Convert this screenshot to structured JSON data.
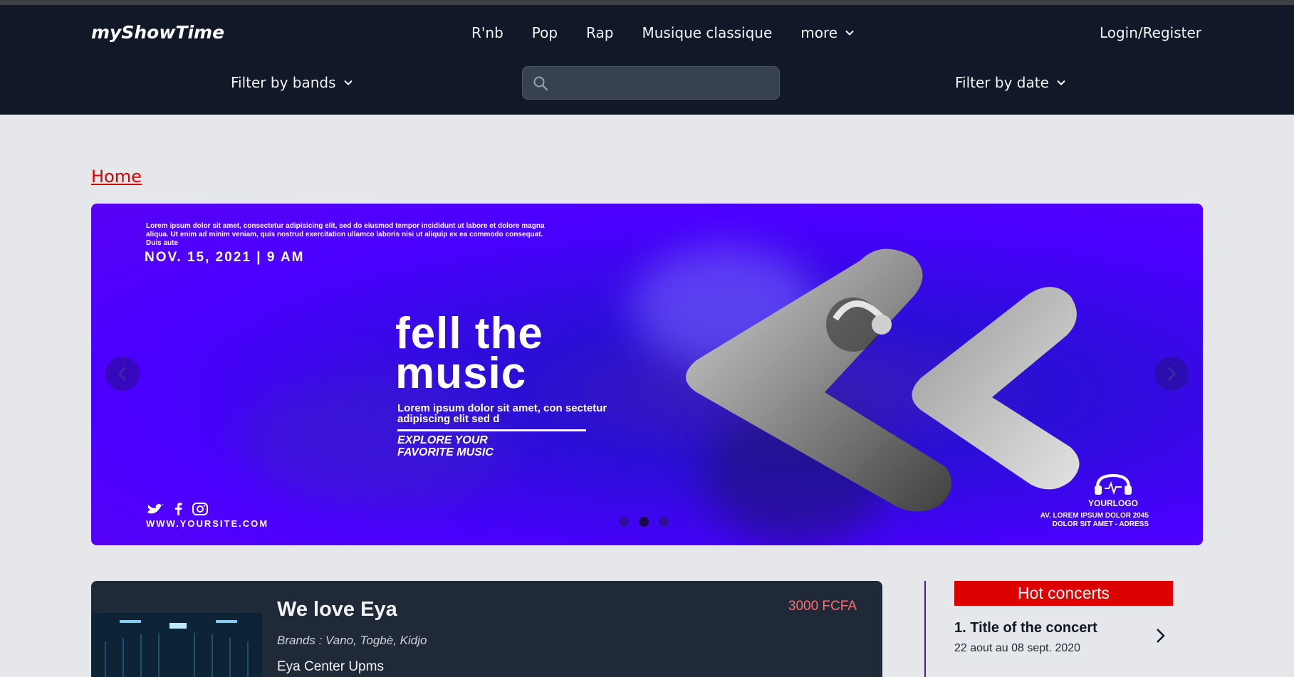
{
  "nav": {
    "brand": "myShowTime",
    "links": [
      "R'nb",
      "Pop",
      "Rap",
      "Musique classique"
    ],
    "more_label": "more",
    "login_label": "Login/Register",
    "filter_bands_label": "Filter by bands",
    "filter_date_label": "Filter by date",
    "search": {
      "placeholder": "",
      "value": ""
    }
  },
  "breadcrumb": {
    "home": "Home"
  },
  "carousel": {
    "small_text": "Lorem ipsum dolor sit amet, consectetur adipisicing elit, sed do eiusmod tempor incididunt ut labore et dolore magna aliqua. Ut enim ad minim veniam, quis nostrud exercitation ullamco laboris nisi ut aliquip ex ea commodo consequat. Duis aute",
    "date": "NOV. 15, 2021 |  9 AM",
    "title_line1": "fell the",
    "title_line2": "music",
    "subtitle": "Lorem ipsum dolor sit amet, con sectetur adipiscing elit sed d",
    "explore_line1": "EXPLORE YOUR",
    "explore_line2": "FAVORITE MUSIC",
    "website": "WWW.YOURSITE.COM",
    "logo_text": "YOURLOGO",
    "address_line1": "AV. LOREM IPSUM DOLOR 2045",
    "address_line2": "DOLOR SIT AMET - ADRESS",
    "dots": 3,
    "active_dot": 1
  },
  "card": {
    "title": "We love Eya",
    "price": "3000 FCFA",
    "brands": "Brands : Vano, Togbè, Kidjo",
    "venue": "Eya Center Upms"
  },
  "hot_concerts": {
    "header": "Hot concerts",
    "items": [
      {
        "title": "1. Title of the concert",
        "date": "22 aout au 08 sept. 2020"
      }
    ]
  },
  "colors": {
    "nav_bg": "#111827",
    "page_bg": "#e5e7eb",
    "accent_red": "#dc0000",
    "price_red": "#f87171",
    "carousel_purple": "#4a00ff"
  }
}
